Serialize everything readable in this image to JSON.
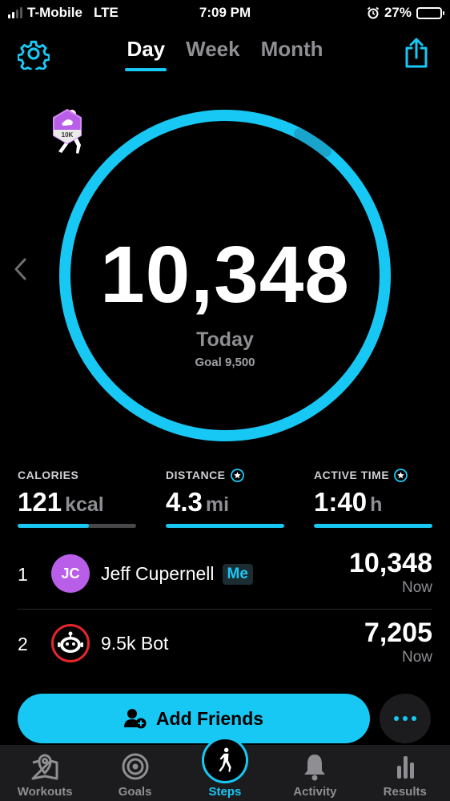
{
  "status_bar": {
    "carrier": "T-Mobile",
    "network": "LTE",
    "time": "7:09 PM",
    "battery": "27%",
    "battery_level": 0.27
  },
  "header": {
    "tabs": [
      {
        "label": "Day",
        "active": true
      },
      {
        "label": "Week",
        "active": false
      },
      {
        "label": "Month",
        "active": false
      }
    ]
  },
  "summary": {
    "steps": "10,348",
    "period": "Today",
    "goal": "Goal 9,500",
    "badge": "10K",
    "ring_progress": 1.0
  },
  "stats": [
    {
      "label": "CALORIES",
      "value": "121",
      "unit": "kcal",
      "progress": 0.6,
      "starred": false
    },
    {
      "label": "DISTANCE",
      "value": "4.3",
      "unit": "mi",
      "progress": 1.0,
      "starred": true
    },
    {
      "label": "ACTIVE TIME",
      "value": "1:40",
      "unit": "h",
      "progress": 1.0,
      "starred": true
    }
  ],
  "leaderboard": [
    {
      "rank": "1",
      "initials": "JC",
      "name": "Jeff Cupernell",
      "tag": "Me",
      "steps": "10,348",
      "when": "Now"
    },
    {
      "rank": "2",
      "initials": "",
      "name": "9.5k Bot",
      "tag": "",
      "steps": "7,205",
      "when": "Now"
    }
  ],
  "actions": {
    "add_friends": "Add Friends"
  },
  "tabbar": [
    {
      "label": "Workouts",
      "icon": "map-pin-icon",
      "active": false
    },
    {
      "label": "Goals",
      "icon": "target-icon",
      "active": false
    },
    {
      "label": "Steps",
      "icon": "walker-icon",
      "active": true
    },
    {
      "label": "Activity",
      "icon": "bell-icon",
      "active": false
    },
    {
      "label": "Results",
      "icon": "bar-chart-icon",
      "active": false
    }
  ],
  "colors": {
    "accent": "#18c8f4",
    "background": "#000000",
    "muted": "#8e8e93",
    "avatar_jc": "#b95ee8",
    "bot_ring": "#e5262b"
  }
}
